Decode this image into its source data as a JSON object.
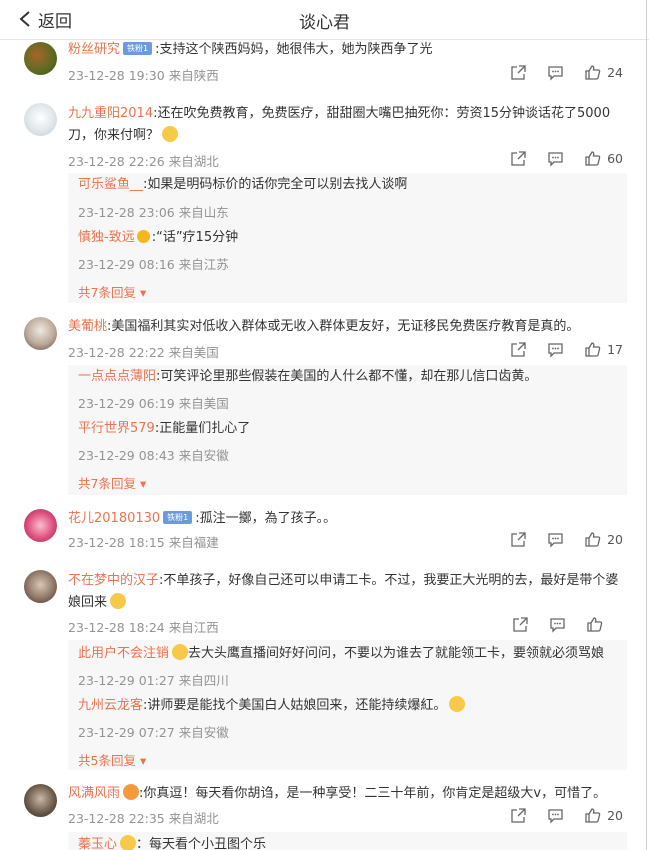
{
  "header": {
    "back_label": "返回",
    "title": "谈心君"
  },
  "comments": [
    {
      "user": "粉丝研究",
      "badge": "铁粉1",
      "text": ":支持这个陕西妈妈，她很伟大，她为陕西争了光",
      "meta": "23-12-28 19:30 来自陕西",
      "likes": "24"
    },
    {
      "user": "九九重阳2014",
      "text": ":还在吹免费教育，免费医疗，甜甜圈大嘴巴抽死你：劳资15分钟谈话花了5000刀，你来付啊？",
      "meta": "23-12-28 22:26 来自湖北",
      "likes": "60",
      "replies": [
        {
          "user": "可乐鲨鱼__",
          "text": ":如果是明码标价的话你完全可以别去找人谈啊",
          "meta": "23-12-28 23:06 来自山东"
        },
        {
          "user": "慎独-致远",
          "text": ":“话”疗15分钟",
          "meta": "23-12-29 08:16 来自江苏"
        }
      ],
      "more": "共7条回复"
    },
    {
      "user": "美葡桃",
      "text": ":美国福利其实对低收入群体或无收入群体更友好，无证移民免费医疗教育是真的。",
      "meta": "23-12-28 22:22 来自美国",
      "likes": "17",
      "replies": [
        {
          "user": "一点点点薄阳",
          "text": ":可笑评论里那些假装在美国的人什么都不懂，却在那儿信口齿黄。",
          "meta": "23-12-29 06:19 来自美国"
        },
        {
          "user": "平行世界579",
          "text": ":正能量们扎心了",
          "meta": "23-12-29 08:43 来自安徽"
        }
      ],
      "more": "共7条回复"
    },
    {
      "user": "花儿20180130",
      "badge": "铁粉1",
      "text": ":孤注一擲，為了孩子。。",
      "meta": "23-12-28 18:15 来自福建",
      "likes": "20"
    },
    {
      "user": "不在梦中的汉子",
      "text": ":不单孩子，好像自己还可以申请工卡。不过，我要正大光明的去，最好是带个婆娘回来",
      "meta": "23-12-28 18:24 来自江西",
      "likes": "",
      "replies": [
        {
          "user": "此用户不会注销",
          "text": "去大头鹰直播间好好问问，不要以为谁去了就能领工卡，要领就必须骂娘",
          "meta": "23-12-29 01:27 来自四川"
        },
        {
          "user": "九州云龙客",
          "text": ":讲师要是能找个美国白人姑娘回来，还能持续爆紅。",
          "meta": "23-12-29 07:27 来自安徽"
        }
      ],
      "more": "共5条回复"
    },
    {
      "user": "风满风雨",
      "text": ":你真逗！每天看你胡诌，是一种享受！二三十年前，你肯定是超级大v，可惜了。",
      "meta": "23-12-28 22:35 来自湖北",
      "likes": "20",
      "replies": [
        {
          "user": "蓁玉心",
          "text": "：每天看个小丑图个乐",
          "meta": ""
        }
      ]
    }
  ],
  "colors": {
    "username": "#eb7350",
    "meta": "#939393",
    "reply_bg": "#f7f7f7"
  },
  "icons": [
    "back-chevron-icon",
    "share-icon",
    "comment-icon",
    "like-icon"
  ]
}
